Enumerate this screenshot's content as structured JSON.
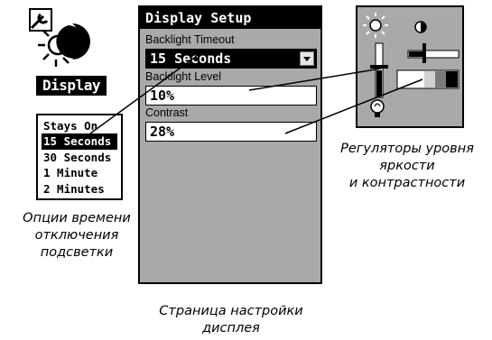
{
  "icon": {
    "label": "Display"
  },
  "screen": {
    "title": "Display Setup",
    "fields": {
      "backlight_timeout": {
        "label": "Backlight Timeout",
        "value": "15 Seconds"
      },
      "backlight_level": {
        "label": "Backlight Level",
        "value": "10%"
      },
      "contrast": {
        "label": "Contrast",
        "value": "28%"
      }
    }
  },
  "timeout_options": {
    "items": [
      "Stays On",
      "15 Seconds",
      "30 Seconds",
      "1 Minute",
      "2 Minutes"
    ],
    "selected": "15 Seconds"
  },
  "level_panel": {
    "icons": [
      "sun-icon",
      "half-circle-contrast-icon",
      "light-bulb-icon"
    ],
    "backlight_level_fraction": 0.1,
    "contrast_level_fraction": 0.28
  },
  "captions": {
    "options": [
      "Опции времени",
      "отключения",
      "подсветки"
    ],
    "controls": [
      "Регуляторы уровня",
      "яркости",
      "и контрастности"
    ],
    "page": [
      "Страница настройки",
      "дисплея"
    ]
  },
  "colors": {
    "screen_bg": "#a9a9a9",
    "ink": "#000000",
    "paper": "#ffffff"
  }
}
